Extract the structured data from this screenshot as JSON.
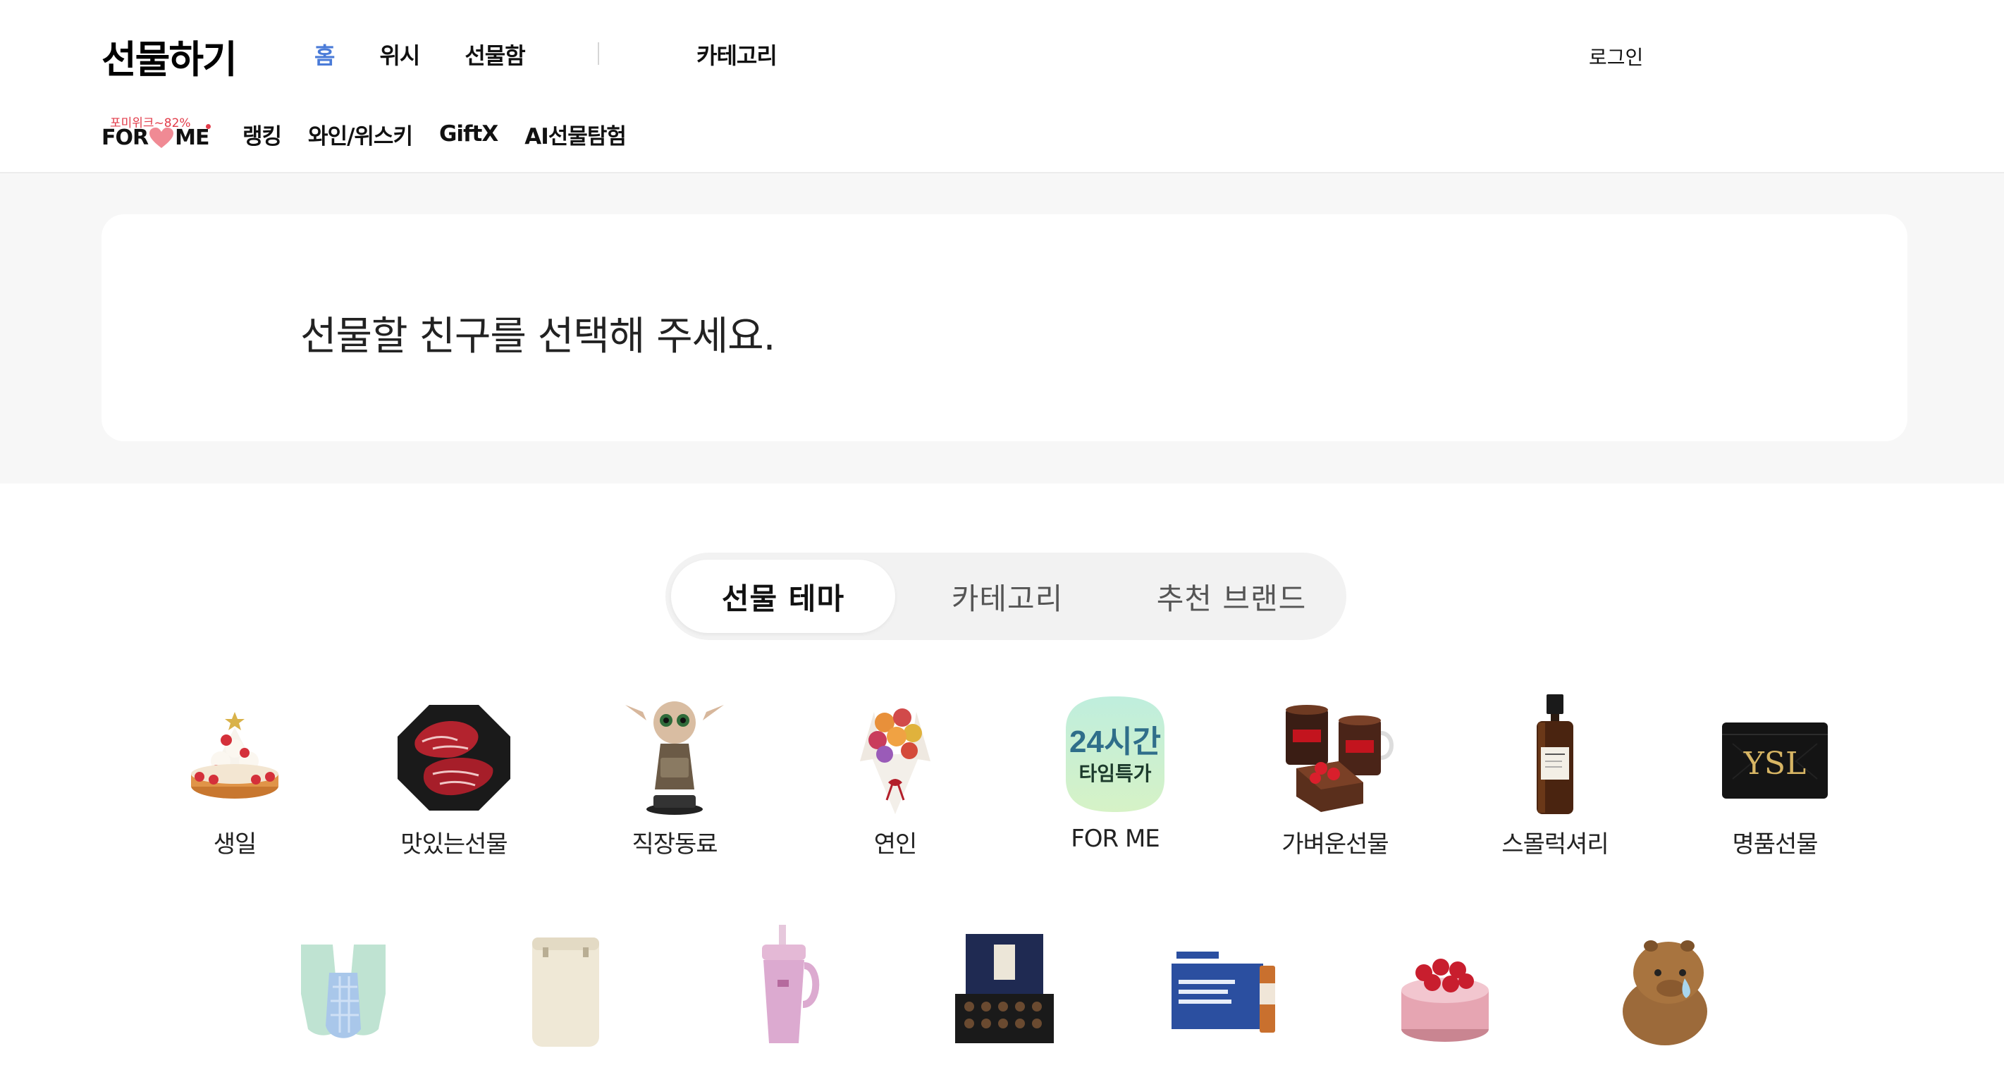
{
  "header": {
    "logo": "선물하기",
    "nav_main": [
      "홈",
      "위시",
      "선물함"
    ],
    "category": "카테고리",
    "login": "로그인",
    "forme": {
      "badge": "포미위크~82%",
      "left": "FOR",
      "right": "ME"
    },
    "nav_sub": [
      "랭킹",
      "와인/위스키",
      "GiftX",
      "AI선물탐험"
    ]
  },
  "friend": {
    "prompt": "선물할 친구를 선택해 주세요."
  },
  "tabs": [
    "선물 테마",
    "카테고리",
    "추천 브랜드"
  ],
  "themes_row1": [
    {
      "label": "생일",
      "icon": "cake-icon"
    },
    {
      "label": "맛있는선물",
      "icon": "beef-icon"
    },
    {
      "label": "직장동료",
      "icon": "figure-icon"
    },
    {
      "label": "연인",
      "icon": "bouquet-icon"
    },
    {
      "label": "FOR ME",
      "icon": "timesale-icon",
      "badge_top": "24시간",
      "badge_bottom": "타임특가"
    },
    {
      "label": "가벼운선물",
      "icon": "coffee-cake-icon"
    },
    {
      "label": "스몰럭셔리",
      "icon": "perfume-icon"
    },
    {
      "label": "명품선물",
      "icon": "card-wallet-icon"
    }
  ],
  "themes_row2": [
    {
      "icon": "socks-icon"
    },
    {
      "icon": "air-purifier-icon"
    },
    {
      "icon": "tumbler-icon"
    },
    {
      "icon": "chocolate-box-icon"
    },
    {
      "icon": "supplement-icon"
    },
    {
      "icon": "strawberry-cake-icon"
    },
    {
      "icon": "capybara-plush-icon"
    }
  ],
  "colors": {
    "accent": "#4a7bd8",
    "badge_red": "#e23c4a",
    "band_gray": "#f7f7f7"
  }
}
